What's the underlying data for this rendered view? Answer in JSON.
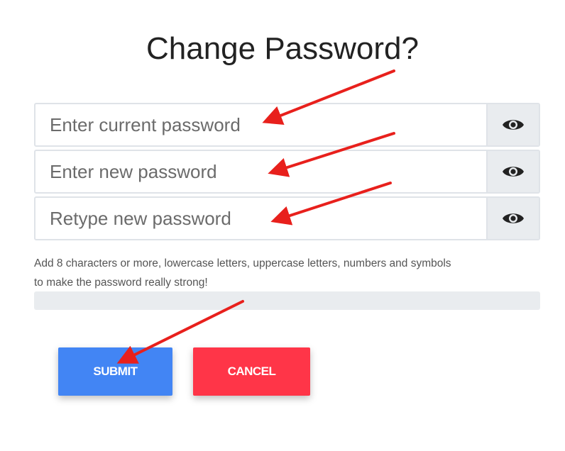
{
  "title": "Change Password?",
  "fields": [
    {
      "placeholder": "Enter current password",
      "value": ""
    },
    {
      "placeholder": "Enter new password",
      "value": ""
    },
    {
      "placeholder": "Retype new password",
      "value": ""
    }
  ],
  "hint_line1": "Add 8 characters or more, lowercase letters, uppercase letters, numbers and symbols",
  "hint_line2": "to make the password really strong!",
  "strength_percent": 0,
  "buttons": {
    "submit": "SUBMIT",
    "cancel": "CANCEL"
  },
  "icons": {
    "toggle_visibility": "eye-icon",
    "annotation": "arrow-icon"
  },
  "colors": {
    "submit": "#4285f4",
    "cancel": "#ff3548",
    "annotation_arrow": "#e8201c",
    "eye_button_bg": "#e9ecef"
  }
}
